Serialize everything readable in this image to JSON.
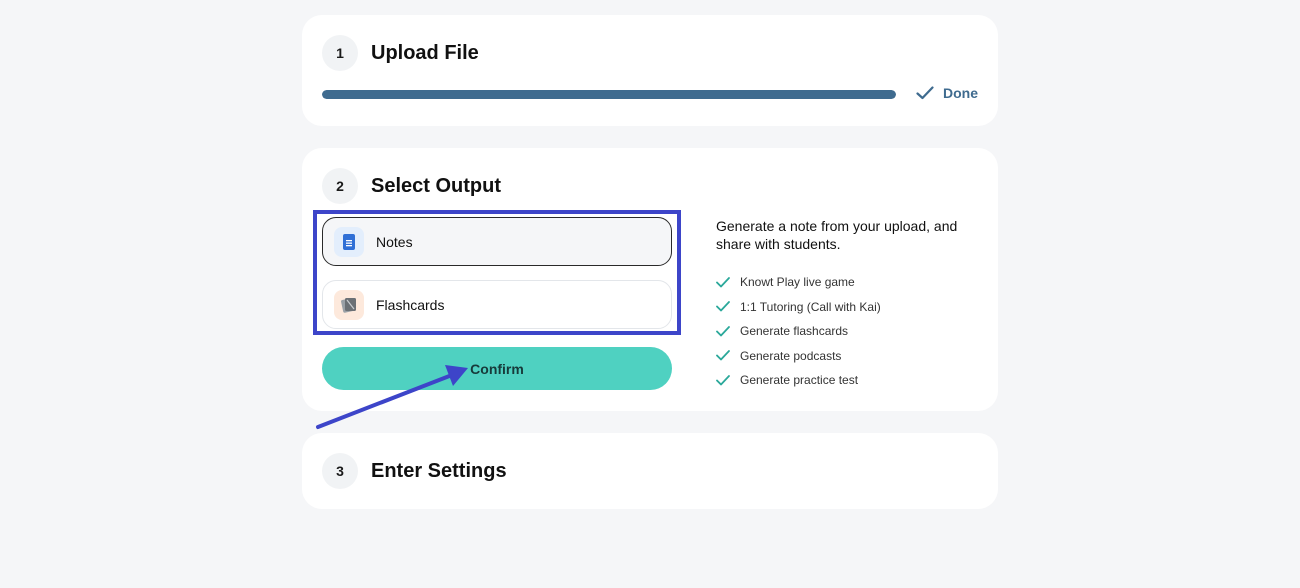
{
  "steps": [
    {
      "number": "1",
      "title": "Upload File"
    },
    {
      "number": "2",
      "title": "Select Output"
    },
    {
      "number": "3",
      "title": "Enter Settings"
    }
  ],
  "upload": {
    "progress_percent": 100,
    "status_label": "Done"
  },
  "output": {
    "options": [
      {
        "label": "Notes",
        "icon": "document-icon",
        "selected": true
      },
      {
        "label": "Flashcards",
        "icon": "flashcards-icon",
        "selected": false
      }
    ],
    "confirm_label": "Confirm",
    "description": "Generate a note from your upload, and share with students.",
    "features": [
      "Knowt Play live game",
      "1:1 Tutoring (Call with Kai)",
      "Generate flashcards",
      "Generate podcasts",
      "Generate practice test"
    ]
  },
  "colors": {
    "accent_teal": "#4fd1c1",
    "progress_blue": "#3f6b8f",
    "annotation_blue": "#3d45c9",
    "check_teal": "#2aa89a"
  }
}
